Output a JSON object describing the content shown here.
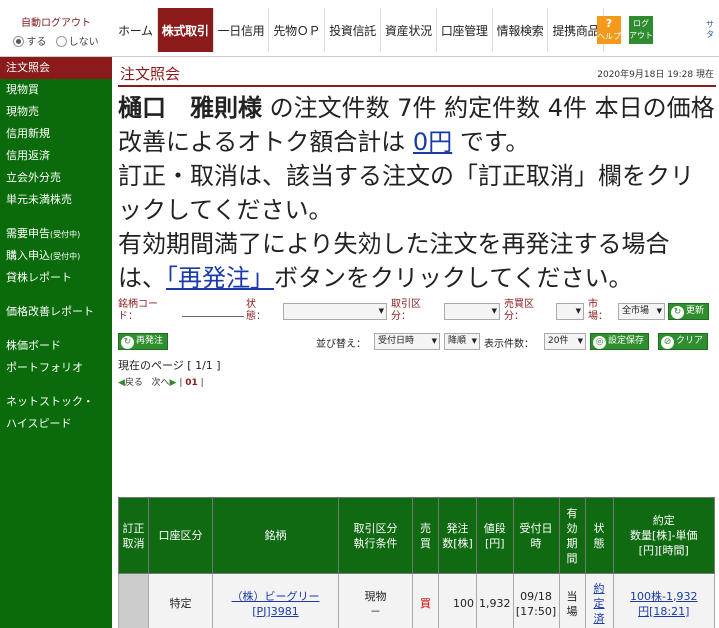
{
  "autologout": {
    "title": "自動ログアウト",
    "opt_on": "する",
    "opt_off": "しない"
  },
  "nav": [
    "ホーム",
    "株式取引",
    "一日信用",
    "先物ＯＰ",
    "投資信託",
    "資産状況",
    "口座管理",
    "情報検索",
    "提携商品"
  ],
  "help_label": [
    "ヘルプ"
  ],
  "logout_label": [
    "ログ",
    "アウト"
  ],
  "top_edge": [
    "サ",
    "タ"
  ],
  "sidebar": [
    "注文照会",
    "現物買",
    "現物売",
    "信用新規",
    "信用返済",
    "立会外分売",
    "単元未満株売",
    "需要申告",
    "(受付中)",
    "購入申込",
    "(受付中)",
    "貸株レポート",
    "価格改善レポート",
    "株価ボード",
    "ポートフォリオ",
    "ネットストック・",
    "ハイスピード"
  ],
  "page_title": "注文照会",
  "timestamp": "2020年9月18日 19:28 現在",
  "summary": {
    "name": "樋口　雅則様",
    "line1_rest": " の注文件数 7件 約定件数 4件 本日の価格改善によるオトク額合計は ",
    "amount_link": "0円",
    "line1_end": " です。",
    "line2": "訂正・取消は、該当する注文の「訂正取消」欄をクリックしてください。",
    "line3_a": "有効期間満了により失効した注文を再発注する場合は、",
    "reissue_link": "「再発注」",
    "line3_b": "ボタンをクリックしてください。"
  },
  "filters": {
    "code_label": [
      "銘柄コー",
      "ド："
    ],
    "status_label": [
      "状",
      "態："
    ],
    "trade_label": [
      "取引区",
      "分："
    ],
    "buysell_label": [
      "売買区",
      "分："
    ],
    "market_label": [
      "市",
      "場："
    ],
    "market_value": "全市場",
    "refresh": "更新",
    "reissue_btn": "再発注",
    "sort_label": "並び替え：",
    "sort_value": "受付日時",
    "order_value": "降順",
    "count_label": "表示件数：",
    "count_value": "20件",
    "save_btn": "設定保存",
    "clear_btn": "クリア"
  },
  "pager": {
    "current": "現在のページ [ 1/1 ]",
    "prev": "戻る",
    "next": "次へ",
    "page": "01"
  },
  "table": {
    "headers": [
      [
        "訂正",
        "取消"
      ],
      [
        "口座区分"
      ],
      [
        "銘柄"
      ],
      [
        "取引区分",
        "執行条件"
      ],
      [
        "売",
        "買"
      ],
      [
        "発注",
        "数[株]"
      ],
      [
        "値段",
        "[円]"
      ],
      [
        "受付日",
        "時"
      ],
      [
        "有",
        "効",
        "期",
        "間"
      ],
      [
        "状",
        "態"
      ],
      [
        "約定",
        "数量[株]-単価",
        "[円][時間]"
      ]
    ],
    "row": {
      "account": "特定",
      "name": "（株）ビーグリー",
      "code": "[PJ]3981",
      "trade": "現物",
      "cond": "－",
      "side": "買",
      "qty": "100",
      "price": "1,932",
      "date": "09/18",
      "time": "[17:50]",
      "period": [
        "当",
        "場"
      ],
      "status": [
        "約",
        "定",
        "済"
      ],
      "exec": [
        "100株-1,932",
        "円[18:21]"
      ]
    }
  },
  "colors": {
    "brand": "#8b1a1a",
    "nav_green": "#0a6b0a",
    "link": "#1a3aa8"
  }
}
